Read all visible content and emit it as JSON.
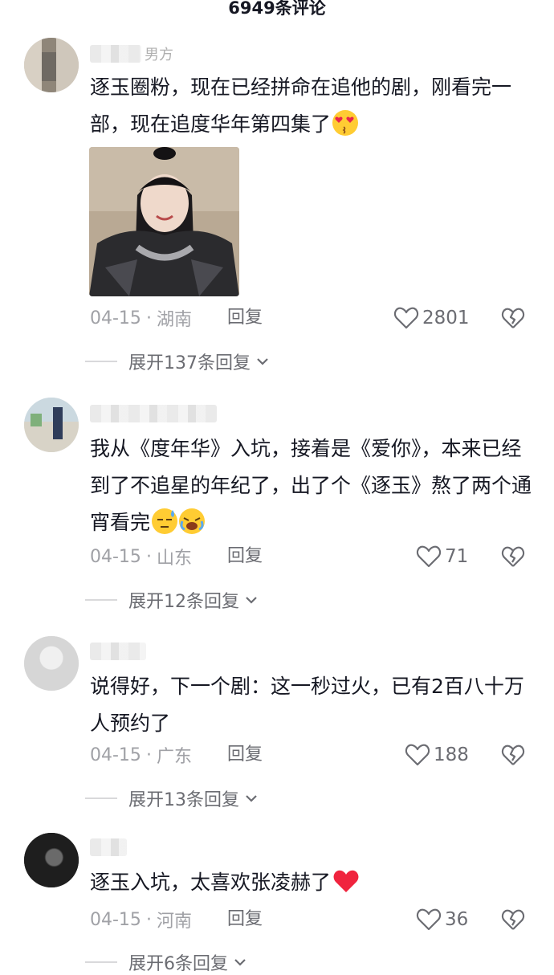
{
  "header": {
    "title": "6949条评论"
  },
  "comments": [
    {
      "username_suffix": "男方",
      "text": "逐玉圈粉，现在已经拼命在追他的剧，刚看完一部，现在追度华年第四集了",
      "emoji": "heart-eyes-kiss-emoji",
      "date": "04-15",
      "location": "湖南",
      "reply_label": "回复",
      "likes": "2801",
      "expand_label": "展开137条回复",
      "has_photo": true
    },
    {
      "username_suffix": "",
      "text": "我从《度年华》入坑，接着是《爱你》，本来已经到了不追星的年纪了，出了个《逐玉》熬了两个通宵看完",
      "emoji": "tired-crying-emoji",
      "date": "04-15",
      "location": "山东",
      "reply_label": "回复",
      "likes": "71",
      "expand_label": "展开12条回复"
    },
    {
      "username_suffix": "",
      "text": "说得好，下一个剧：这一秒过火，已有2百八十万人预约了",
      "date": "04-15",
      "location": "广东",
      "reply_label": "回复",
      "likes": "188",
      "expand_label": "展开13条回复"
    },
    {
      "username_suffix": "",
      "text": "逐玉入坑，太喜欢张凌赫了",
      "emoji": "red-heart-emoji",
      "date": "04-15",
      "location": "河南",
      "reply_label": "回复",
      "likes": "36",
      "expand_label": "展开6条回复"
    }
  ],
  "separator": "·",
  "colors": {
    "text": "#161823",
    "meta": "#a0a1a6",
    "secondary": "#6b6c72",
    "heart_red": "#fe2c55"
  }
}
